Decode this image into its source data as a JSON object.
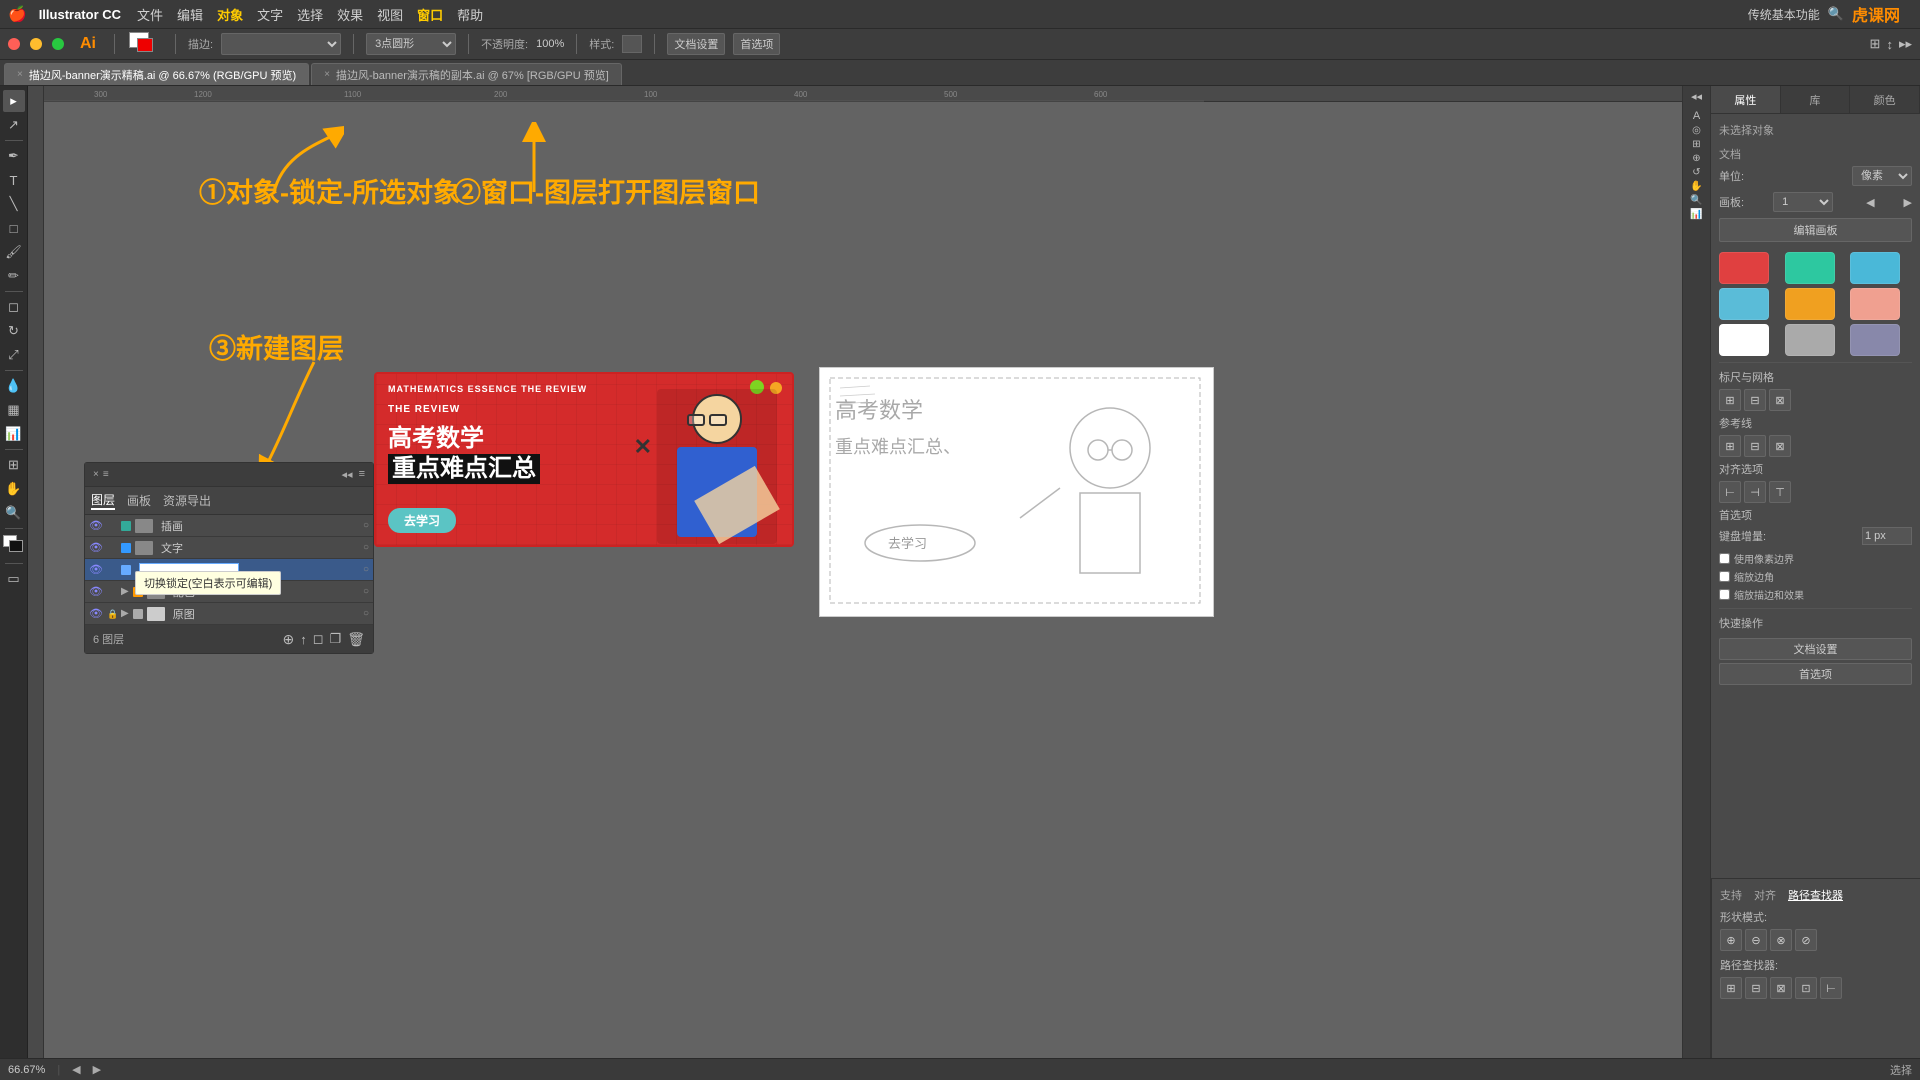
{
  "app": {
    "name": "Illustrator CC",
    "title": "Ai"
  },
  "menu": {
    "apple": "🍎",
    "app_name": "Illustrator CC",
    "items": [
      "文件",
      "编辑",
      "对象",
      "文字",
      "选择",
      "效果",
      "视图",
      "窗口",
      "帮助"
    ]
  },
  "toolbar": {
    "no_selection": "未选择对象",
    "stroke_label": "描边:",
    "point_shape": "3点圆形",
    "opacity_label": "不透明度:",
    "opacity_value": "100%",
    "style_label": "样式:",
    "doc_settings": "文档设置",
    "preferences": "首选项"
  },
  "tabs": [
    {
      "label": "描边风-banner演示精稿.ai @ 66.67% (RGB/GPU 预览)",
      "active": true
    },
    {
      "label": "描边风-banner演示稿的副本.ai @ 67% [RGB/GPU 预览]",
      "active": false
    }
  ],
  "annotations": {
    "ann1": "①对象-锁定-所选对象",
    "ann2": "②窗口-图层打开图层窗口",
    "ann3": "③新建图层"
  },
  "layers_panel": {
    "title": "图层",
    "tabs": [
      "图层",
      "画板",
      "资源导出"
    ],
    "layers": [
      {
        "name": "插画",
        "visible": true,
        "locked": false,
        "color": "#3a9",
        "has_thumb": true
      },
      {
        "name": "文字",
        "visible": true,
        "locked": false,
        "color": "#39f",
        "has_thumb": true
      },
      {
        "name": "",
        "visible": true,
        "locked": false,
        "color": "#6af",
        "has_thumb": false,
        "editing": true
      },
      {
        "name": "配色",
        "visible": true,
        "locked": false,
        "color": "#f90",
        "has_thumb": true,
        "expanded": true,
        "sub": true
      },
      {
        "name": "原图",
        "visible": true,
        "locked": true,
        "color": "#aaa",
        "has_thumb": true,
        "expanded": true
      }
    ],
    "footer_count": "6 图层",
    "tooltip": "切换锁定(空白表示可编辑)"
  },
  "math_banner": {
    "top_text": "MATHEMATICS ESSENCE THE REVIEW",
    "title_line1": "高考数学",
    "title_line2": "重点难点汇总",
    "button_text": "去学习"
  },
  "right_panel": {
    "tabs": [
      "属性",
      "库",
      "颜色"
    ],
    "section_no_selection": "未选择对象",
    "doc_section": "文档",
    "unit_label": "单位:",
    "unit_value": "像素",
    "artboard_label": "画板:",
    "artboard_value": "1",
    "edit_artboard_btn": "编辑画板",
    "ruler_grid_label": "标尺与网格",
    "guides_label": "参考线",
    "align_label": "对齐选项",
    "prefs_label": "首选项",
    "keyboard_increment_label": "键盘增量:",
    "keyboard_increment_value": "1 px",
    "snap_pixel_label": "使用像素边界",
    "corner_label": "缩放边角",
    "scale_stroke_label": "缩放描边和效果",
    "quick_actions": "快速操作",
    "doc_settings_btn": "文档设置",
    "preferences_btn": "首选项",
    "swatches": [
      {
        "color": "#e04040",
        "name": "red"
      },
      {
        "color": "#2dc8a0",
        "name": "teal"
      },
      {
        "color": "#4ab8d8",
        "name": "light-blue"
      },
      {
        "color": "#5abcd8",
        "name": "cyan"
      },
      {
        "color": "#f0a020",
        "name": "orange"
      },
      {
        "color": "#f0a090",
        "name": "salmon"
      },
      {
        "color": "#ffffff",
        "name": "white"
      },
      {
        "color": "#aaaaaa",
        "name": "gray"
      },
      {
        "color": "#8888aa",
        "name": "purple-gray"
      }
    ]
  },
  "bottom_right": {
    "tabs": [
      "支持",
      "对齐",
      "路径查找器"
    ],
    "active_tab": "路径查找器",
    "shape_modes_label": "形状模式:",
    "path_finder_label": "路径查找器:"
  },
  "status_bar": {
    "zoom": "66.67%",
    "mode": "选择"
  },
  "brand": {
    "logo": "虎课网",
    "label": "传统基本功能"
  }
}
